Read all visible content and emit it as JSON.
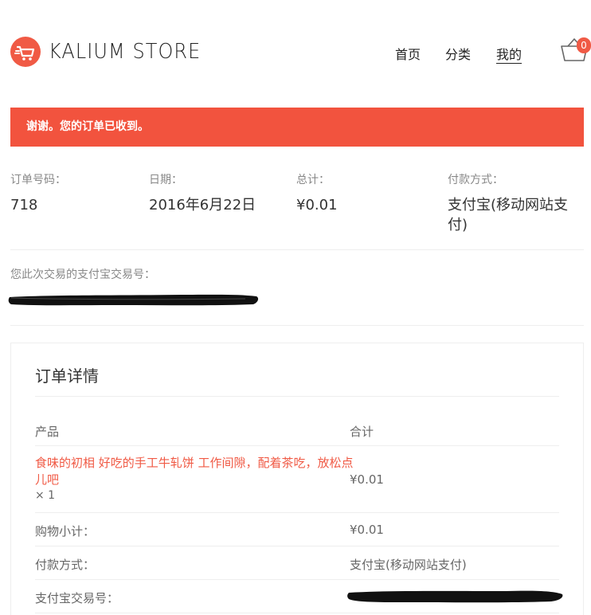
{
  "header": {
    "brand": "KALIUM STORE",
    "nav": {
      "home": "首页",
      "category": "分类",
      "mine": "我的"
    },
    "cart_count": "0",
    "accent_color": "#f05a45"
  },
  "notice": {
    "text": "谢谢。您的订单已收到。",
    "color": "#f2533e"
  },
  "overview": {
    "order_number_label": "订单号码：",
    "order_number": "718",
    "date_label": "日期：",
    "date": "2016年6月22日",
    "total_label": "总计：",
    "total": "¥0.01",
    "payment_label": "付款方式：",
    "payment": "支付宝(移动网站支付)"
  },
  "trade": {
    "label": "您此次交易的支付宝交易号："
  },
  "details": {
    "title": "订单详情",
    "col_product": "产品",
    "col_total": "合计",
    "item": {
      "name": "食味的初相 好吃的手工牛轧饼 工作间隙，配着茶吃，放松点儿吧",
      "qty": "× 1",
      "price": "¥0.01"
    },
    "subtotal_label": "购物小计：",
    "subtotal": "¥0.01",
    "payment_label": "付款方式：",
    "payment": "支付宝(移动网站支付)",
    "trade_no_label": "支付宝交易号："
  }
}
